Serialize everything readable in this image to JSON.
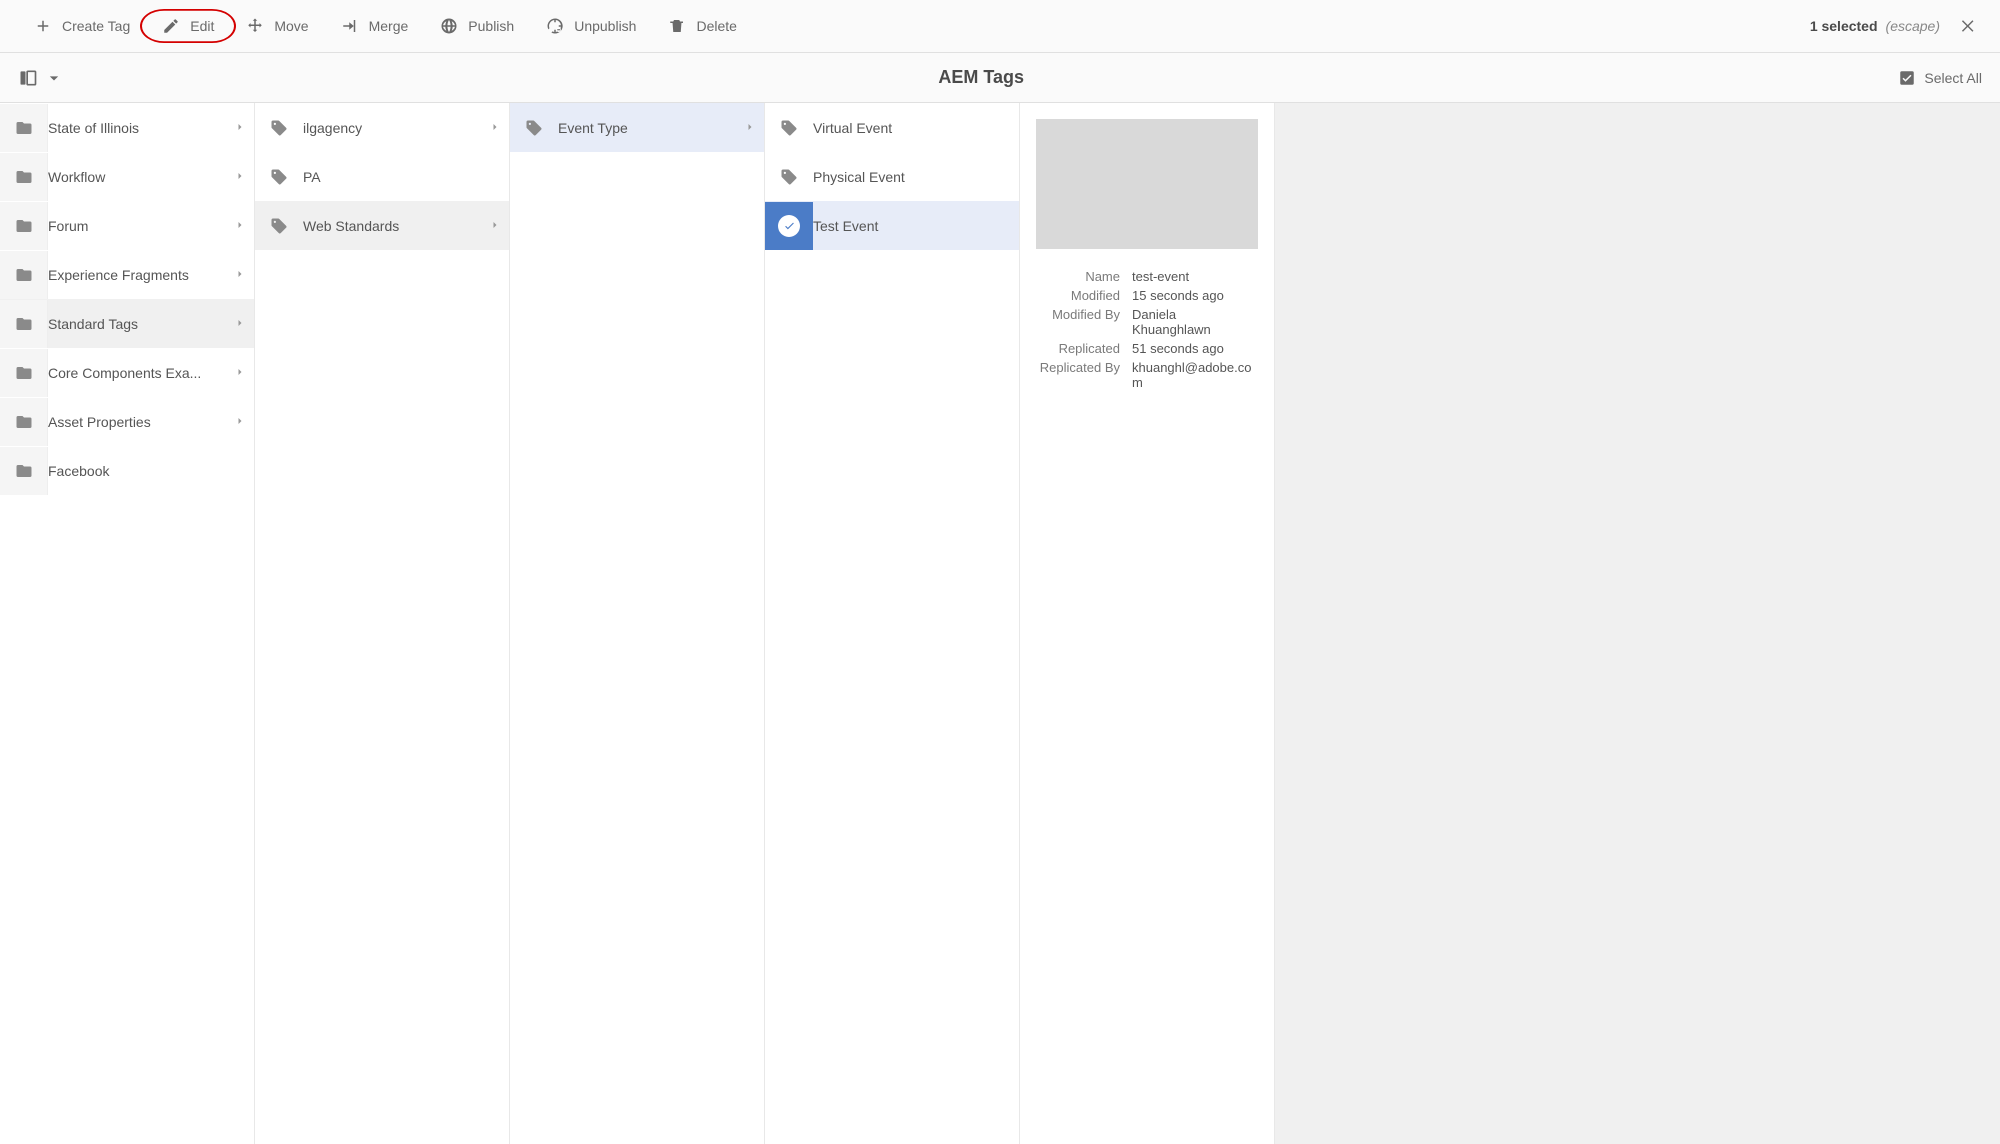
{
  "toolbar": {
    "create_tag": "Create Tag",
    "edit": "Edit",
    "move": "Move",
    "merge": "Merge",
    "publish": "Publish",
    "unpublish": "Unpublish",
    "delete": "Delete",
    "selection_count": "1 selected",
    "escape": "(escape)"
  },
  "subheader": {
    "title": "AEM Tags",
    "select_all": "Select All"
  },
  "col1": {
    "items": [
      {
        "label": "State of Illinois",
        "has_children": true
      },
      {
        "label": "Workflow",
        "has_children": true
      },
      {
        "label": "Forum",
        "has_children": true
      },
      {
        "label": "Experience Fragments",
        "has_children": true
      },
      {
        "label": "Standard Tags",
        "has_children": true,
        "selected": true
      },
      {
        "label": "Core Components Exa...",
        "has_children": true
      },
      {
        "label": "Asset Properties",
        "has_children": true
      },
      {
        "label": "Facebook",
        "has_children": false
      }
    ]
  },
  "col2": {
    "items": [
      {
        "label": "ilgagency",
        "has_children": true
      },
      {
        "label": "PA",
        "has_children": false
      },
      {
        "label": "Web Standards",
        "has_children": true,
        "selected": true
      }
    ]
  },
  "col3": {
    "items": [
      {
        "label": "Event Type",
        "has_children": true,
        "selected": true
      }
    ]
  },
  "col4": {
    "items": [
      {
        "label": "Virtual Event"
      },
      {
        "label": "Physical Event"
      },
      {
        "label": "Test Event",
        "final_selected": true
      }
    ]
  },
  "detail": {
    "fields": {
      "name_k": "Name",
      "name_v": "test-event",
      "modified_k": "Modified",
      "modified_v": "15 seconds ago",
      "modified_by_k": "Modified By",
      "modified_by_v": "Daniela Khuanghlawn",
      "replicated_k": "Replicated",
      "replicated_v": "51 seconds ago",
      "replicated_by_k": "Replicated By",
      "replicated_by_v": "khuanghl@adobe.com"
    }
  }
}
